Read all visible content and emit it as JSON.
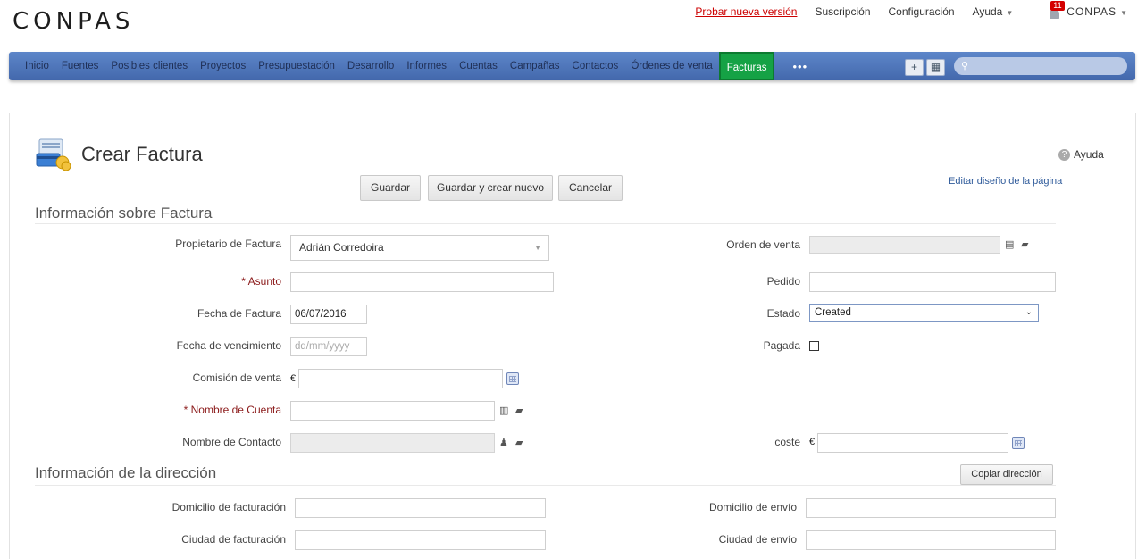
{
  "header": {
    "logo_text": "CONPAS",
    "try_new_version": "Probar nueva versión",
    "subscription": "Suscripción",
    "configuration": "Configuración",
    "help_menu": "Ayuda",
    "notifications_count": "11",
    "mini_logo": "CONPAS"
  },
  "nav": {
    "items": [
      "Inicio",
      "Fuentes",
      "Posibles clientes",
      "Proyectos",
      "Presupuestación",
      "Desarrollo",
      "Informes",
      "Cuentas",
      "Campañas",
      "Contactos",
      "Órdenes de venta"
    ],
    "active": "Facturas",
    "more": "•••",
    "quick_create": "+",
    "search_placeholder": ""
  },
  "page": {
    "title": "Crear Factura",
    "help": "Ayuda",
    "edit_layout": "Editar diseño de la página",
    "buttons": {
      "save": "Guardar",
      "save_new": "Guardar y crear nuevo",
      "cancel": "Cancelar"
    }
  },
  "invoice_info": {
    "section_title": "Información sobre Factura",
    "owner_label": "Propietario de Factura",
    "owner_value": "Adrián Corredoira",
    "subject_label": "Asunto",
    "subject_value": "",
    "date_label": "Fecha de Factura",
    "date_value": "06/07/2016",
    "due_label": "Fecha de vencimiento",
    "due_placeholder": "dd/mm/yyyy",
    "commission_label": "Comisión de venta",
    "currency": "€",
    "account_label": "Nombre de Cuenta",
    "contact_label": "Nombre de Contacto",
    "sales_order_label": "Orden de venta",
    "order_label": "Pedido",
    "status_label": "Estado",
    "status_value": "Created",
    "paid_label": "Pagada",
    "paid_checked": false,
    "cost_label": "coste"
  },
  "address_info": {
    "section_title": "Información de la dirección",
    "copy_button": "Copiar dirección",
    "billing_street_label": "Domicilio de facturación",
    "shipping_street_label": "Domicilio de envío",
    "billing_city_label": "Ciudad de facturación",
    "shipping_city_label": "Ciudad de envío"
  },
  "colors": {
    "nav_bg": "#4f75bb",
    "active_tab": "#15a245",
    "required": "#8b1a1a",
    "link": "#2e5a9a"
  }
}
